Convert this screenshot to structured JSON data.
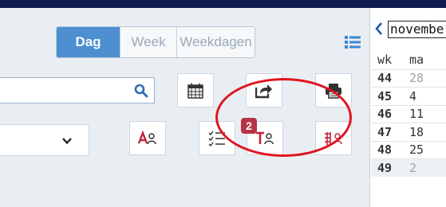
{
  "view_switch": {
    "dag": "Dag",
    "week": "Week",
    "weekdagen": "Weekdagen",
    "active": "Dag"
  },
  "search": {
    "value": "",
    "placeholder": ""
  },
  "badge": {
    "count": "2"
  },
  "mini_calendar": {
    "month": "november",
    "prev_icon": "chevron-left-icon",
    "headers": {
      "week": "wk",
      "day": "ma"
    },
    "rows": [
      {
        "wk": "44",
        "day": "28",
        "other_month": true
      },
      {
        "wk": "45",
        "day": "4",
        "other_month": false
      },
      {
        "wk": "46",
        "day": "11",
        "other_month": false
      },
      {
        "wk": "47",
        "day": "18",
        "other_month": false
      },
      {
        "wk": "48",
        "day": "25",
        "other_month": false
      },
      {
        "wk": "49",
        "day": "2",
        "other_month": true
      }
    ]
  },
  "icons": [
    "list-view-icon",
    "search-icon",
    "calendar-icon",
    "share-icon",
    "print-icon",
    "chevron-down-icon",
    "assign-teacher-icon",
    "task-list-icon",
    "assign-task-icon",
    "grid-assign-icon"
  ],
  "colors": {
    "active_tab": "#4d8fd0",
    "badge": "#b53448",
    "highlight": "#e0141e",
    "topbar": "#0d1b4d"
  }
}
